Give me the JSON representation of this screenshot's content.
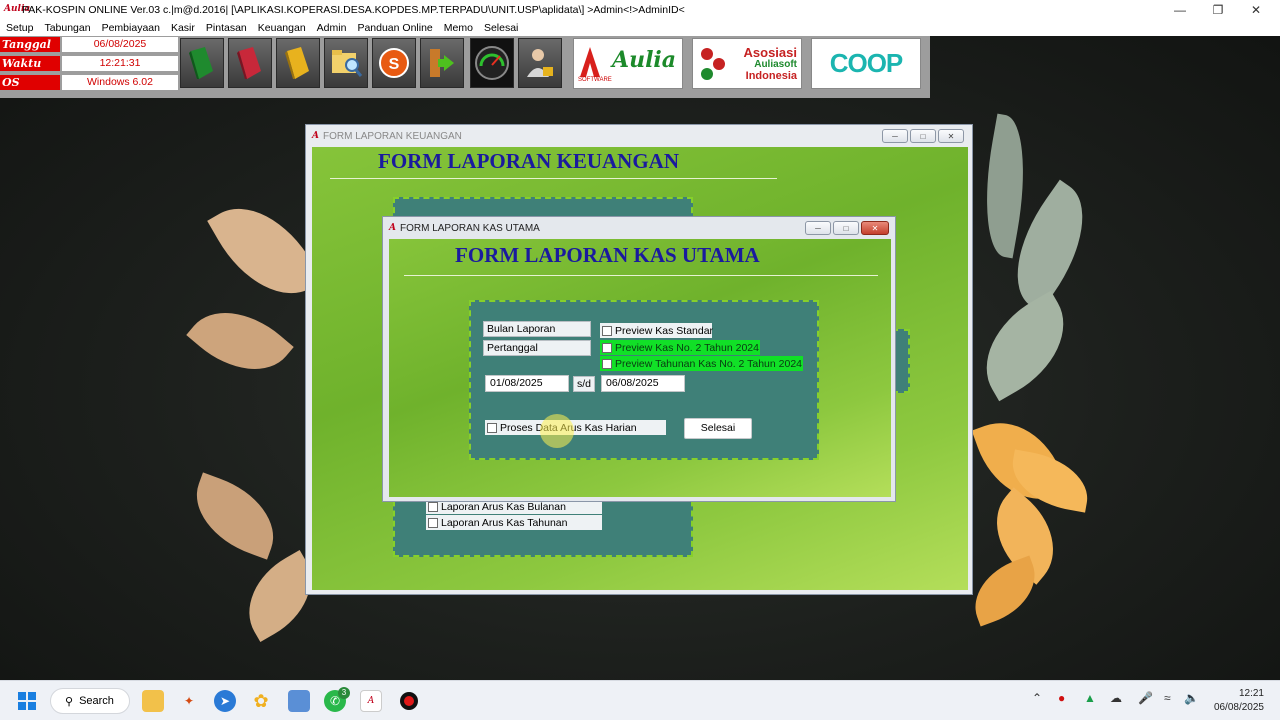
{
  "app": {
    "title": "PAK-KOSPIN ONLINE Ver.03 c.|m@d.2016| [\\APLIKASI.KOPERASI.DESA.KOPDES.MP.TERPADU\\UNIT.USP\\aplidata\\] >Admin<!>AdminID<",
    "icon_text": "Aulia"
  },
  "menu": [
    "Setup",
    "Tabungan",
    "Pembiayaan",
    "Kasir",
    "Pintasan",
    "Keuangan",
    "Admin",
    "Panduan Online",
    "Memo",
    "Selesai"
  ],
  "info": [
    {
      "label": "Tanggal",
      "value": "06/08/2025"
    },
    {
      "label": "Waktu",
      "value": "12:21:31"
    },
    {
      "label": "OS",
      "value": "Windows 6.02"
    }
  ],
  "toolbar_icons": [
    "green-book-icon",
    "red-book-icon",
    "yellow-book-icon",
    "folder-search-icon",
    "s-coin-icon",
    "exit-door-icon",
    "gauge-icon",
    "user-lock-icon"
  ],
  "logos": {
    "aulia": {
      "brand": "Aulia",
      "sub": "SOFTWARE"
    },
    "asosiasi": {
      "line1": "Asosiasi",
      "line2": "Auliasoft",
      "line3": "Indonesia"
    },
    "coop": {
      "text": "COOP"
    }
  },
  "form_keuangan": {
    "window_title": "FORM LAPORAN KEUANGAN",
    "heading": "FORM LAPORAN KEUANGAN",
    "items": [
      "Laporan Arus Kas Bulanan",
      "Laporan Arus Kas Tahunan"
    ]
  },
  "form_kas": {
    "window_title": "FORM LAPORAN KAS UTAMA",
    "heading": "FORM LAPORAN KAS UTAMA",
    "bulan_laporan": "Bulan Laporan",
    "pertanggal": "Pertanggal",
    "preview_standar": "Preview Kas Standar",
    "preview_kas_no2": "Preview Kas No. 2 Tahun 2024",
    "preview_tahunan": "Preview Tahunan Kas No. 2 Tahun 2024",
    "date_from": "01/08/2025",
    "sd_label": "s/d",
    "date_to": "06/08/2025",
    "proses_label": "Proses Data Arus Kas Harian",
    "selesai_button": "Selesai"
  },
  "taskbar": {
    "search_label": "Search",
    "whatsapp_badge": "3",
    "time": "12:21",
    "date": "06/08/2025"
  },
  "colors": {
    "info_label_bg": "#e00000",
    "form_heading": "#1a1a9e",
    "teal_panel": "#3f8078",
    "green_check": "#11e027"
  }
}
